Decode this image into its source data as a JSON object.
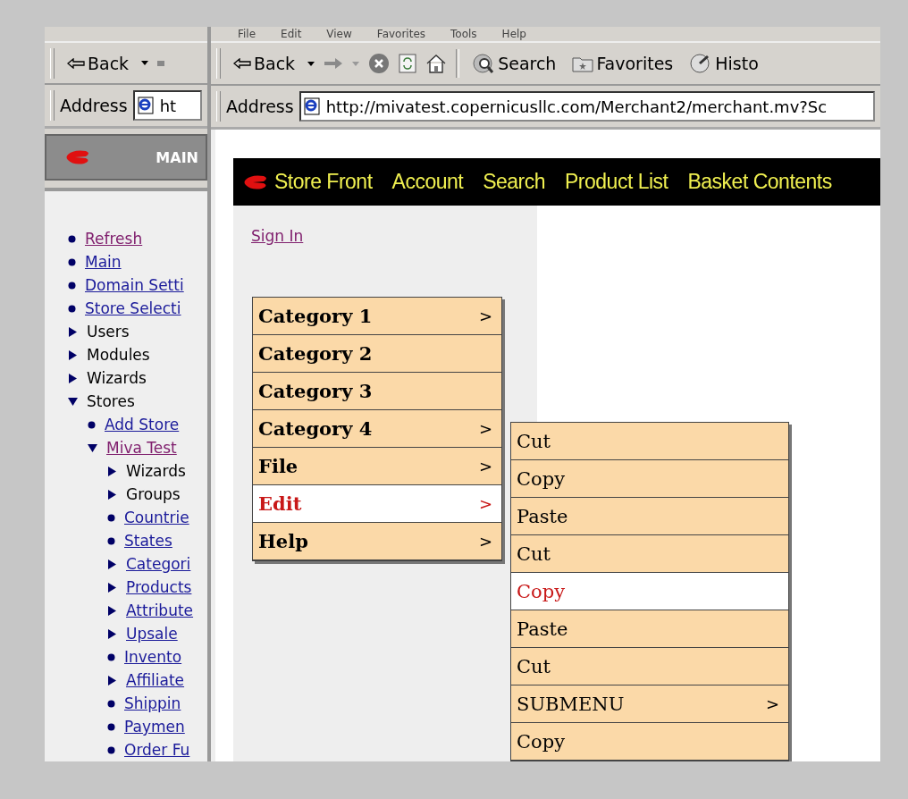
{
  "left_window": {
    "toolbar": {
      "back": "Back"
    },
    "address": {
      "label": "Address",
      "value": "ht"
    },
    "sidebar": {
      "title": "MAIN",
      "tree": [
        {
          "label": "Refresh",
          "kind": "leaf",
          "link": true,
          "visited": true
        },
        {
          "label": "Main",
          "kind": "leaf",
          "link": true,
          "visited": false
        },
        {
          "label": "Domain Setti",
          "kind": "leaf",
          "link": true,
          "visited": false
        },
        {
          "label": "Store Selecti",
          "kind": "leaf",
          "link": true,
          "visited": false
        },
        {
          "label": "Users",
          "kind": "folder",
          "link": false,
          "visited": false,
          "expanded": false
        },
        {
          "label": "Modules",
          "kind": "folder",
          "link": false,
          "visited": false,
          "expanded": false
        },
        {
          "label": "Wizards",
          "kind": "folder",
          "link": false,
          "visited": false,
          "expanded": false
        },
        {
          "label": "Stores",
          "kind": "folder",
          "link": false,
          "visited": false,
          "expanded": true,
          "children": [
            {
              "label": "Add Store",
              "kind": "leaf",
              "link": true,
              "visited": false
            },
            {
              "label": "Miva Test",
              "kind": "folder",
              "link": true,
              "visited": true,
              "expanded": true,
              "children": [
                {
                  "label": "Wizards",
                  "kind": "folder",
                  "link": false,
                  "visited": false,
                  "expanded": false
                },
                {
                  "label": "Groups",
                  "kind": "folder",
                  "link": false,
                  "visited": false,
                  "expanded": false
                },
                {
                  "label": "Countrie",
                  "kind": "leaf",
                  "link": true,
                  "visited": false
                },
                {
                  "label": "States",
                  "kind": "leaf",
                  "link": true,
                  "visited": false
                },
                {
                  "label": "Categori",
                  "kind": "folder",
                  "link": true,
                  "visited": false,
                  "expanded": false
                },
                {
                  "label": "Products",
                  "kind": "folder",
                  "link": true,
                  "visited": false,
                  "expanded": false
                },
                {
                  "label": "Attribute",
                  "kind": "folder",
                  "link": true,
                  "visited": false,
                  "expanded": false
                },
                {
                  "label": "Upsale",
                  "kind": "folder",
                  "link": true,
                  "visited": false,
                  "expanded": false
                },
                {
                  "label": "Invento",
                  "kind": "leaf",
                  "link": true,
                  "visited": false
                },
                {
                  "label": "Affiliate",
                  "kind": "folder",
                  "link": true,
                  "visited": false,
                  "expanded": false
                },
                {
                  "label": "Shippin",
                  "kind": "leaf",
                  "link": true,
                  "visited": false
                },
                {
                  "label": "Paymen",
                  "kind": "leaf",
                  "link": true,
                  "visited": false
                },
                {
                  "label": "Order Fu",
                  "kind": "leaf",
                  "link": true,
                  "visited": false
                }
              ]
            }
          ]
        }
      ]
    }
  },
  "right_window": {
    "menu_bar": [
      "File",
      "Edit",
      "View",
      "Favorites",
      "Tools",
      "Help"
    ],
    "toolbar": {
      "back": "Back",
      "search": "Search",
      "favorites": "Favorites",
      "history": "Histo"
    },
    "address": {
      "label": "Address",
      "value": "http://mivatest.copernicusllc.com/Merchant2/merchant.mv?Sc"
    },
    "store_nav": [
      "Store Front",
      "Account",
      "Search",
      "Product List",
      "Basket Contents"
    ],
    "sign_in": "Sign In",
    "menu": [
      {
        "label": "Category 1",
        "arrow": ">",
        "selected": false
      },
      {
        "label": "Category 2",
        "selected": false
      },
      {
        "label": "Category 3",
        "selected": false
      },
      {
        "label": "Category 4",
        "arrow": ">",
        "selected": false
      },
      {
        "label": "File",
        "arrow": ">",
        "selected": false
      },
      {
        "label": "Edit",
        "arrow": ">",
        "selected": true
      },
      {
        "label": "Help",
        "arrow": ">",
        "selected": false
      }
    ],
    "submenu": [
      {
        "label": "Cut",
        "selected": false
      },
      {
        "label": "Copy",
        "selected": false
      },
      {
        "label": "Paste",
        "selected": false
      },
      {
        "label": "Cut",
        "selected": false
      },
      {
        "label": "Copy",
        "selected": true
      },
      {
        "label": "Paste",
        "selected": false
      },
      {
        "label": "Cut",
        "selected": false
      },
      {
        "label": "SUBMENU",
        "arrow": ">",
        "selected": false
      },
      {
        "label": "Copy",
        "selected": false
      }
    ]
  }
}
